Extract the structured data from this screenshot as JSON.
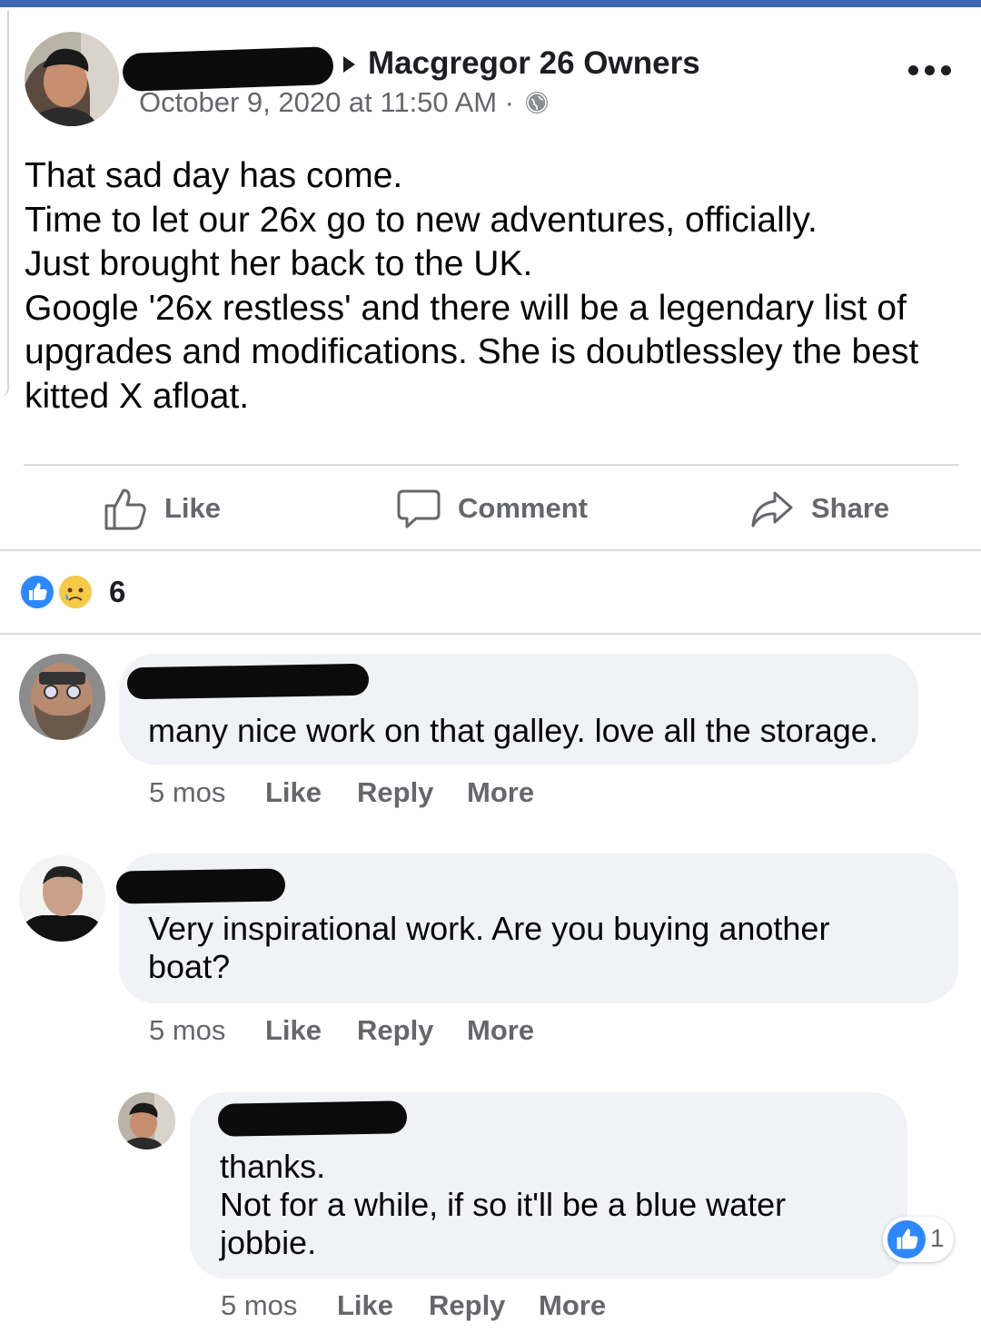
{
  "post": {
    "group_name": "Macgregor 26 Owners",
    "timestamp": "October 9, 2020 at 11:50 AM ·",
    "privacy_icon": "globe-icon",
    "text_lines": [
      "That sad day has come.",
      "Time to let our 26x go to new adventures, officially.",
      "Just brought her back to the UK.",
      "Google '26x restless' and there will be a legendary list of",
      "upgrades and modifications. She is doubtlessley the best",
      "kitted X afloat."
    ]
  },
  "actions": {
    "like": "Like",
    "comment": "Comment",
    "share": "Share"
  },
  "reactions": {
    "count": "6",
    "icons": [
      "like-reaction-icon",
      "sad-reaction-icon"
    ]
  },
  "comments": [
    {
      "lines": [
        "many nice work on that galley. love all the storage."
      ],
      "time": "5 mos",
      "like": "Like",
      "reply": "Reply",
      "more": "More"
    },
    {
      "lines": [
        "Very inspirational work. Are you buying another",
        "boat?"
      ],
      "time": "5 mos",
      "like": "Like",
      "reply": "Reply",
      "more": "More"
    },
    {
      "lines": [
        "thanks.",
        "Not for a while, if so it'll be a blue water",
        "jobbie."
      ],
      "time": "5 mos",
      "like": "Like",
      "reply": "Reply",
      "more": "More",
      "reaction_count": "1"
    }
  ],
  "colors": {
    "accent": "#4267b2",
    "like_blue": "#2d88ff",
    "bubble": "#f0f2f5",
    "meta_gray": "#65676b"
  }
}
